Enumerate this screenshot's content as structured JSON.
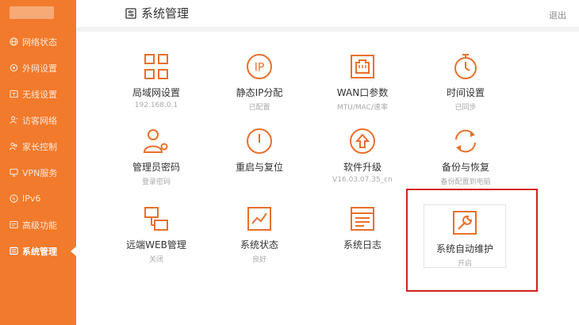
{
  "header": {
    "title": "系统管理",
    "logout": "退出"
  },
  "sidebar": {
    "items": [
      {
        "label": "网络状态",
        "icon": "globe-icon"
      },
      {
        "label": "外网设置",
        "icon": "wan-settings-icon"
      },
      {
        "label": "无线设置",
        "icon": "wireless-icon"
      },
      {
        "label": "访客网络",
        "icon": "guest-icon"
      },
      {
        "label": "家长控制",
        "icon": "parental-control-icon"
      },
      {
        "label": "VPN服务",
        "icon": "vpn-shield-icon"
      },
      {
        "label": "IPv6",
        "icon": "ipv6-icon"
      },
      {
        "label": "高级功能",
        "icon": "advanced-icon"
      },
      {
        "label": "系统管理",
        "icon": "system-management-icon",
        "active": true
      }
    ]
  },
  "tiles": [
    {
      "label": "局域网设置",
      "sub": "192.168.0.1",
      "icon": "lan-icon"
    },
    {
      "label": "静态IP分配",
      "sub": "已配置",
      "icon": "ip-icon"
    },
    {
      "label": "WAN口参数",
      "sub": "MTU/MAC/速率",
      "icon": "wan-port-icon"
    },
    {
      "label": "时间设置",
      "sub": "已同步",
      "icon": "clock-icon"
    },
    {
      "label": "管理员密码",
      "sub": "登录密码",
      "icon": "admin-key-icon"
    },
    {
      "label": "重启与复位",
      "sub": "",
      "icon": "power-icon"
    },
    {
      "label": "软件升级",
      "sub": "V16.03.07.35_cn",
      "icon": "upgrade-icon"
    },
    {
      "label": "备份与恢复",
      "sub": "备份配置到电脑",
      "icon": "backup-restore-icon"
    },
    {
      "label": "远端WEB管理",
      "sub": "关闭",
      "icon": "remote-web-icon"
    },
    {
      "label": "系统状态",
      "sub": "良好",
      "icon": "system-status-icon"
    },
    {
      "label": "系统日志",
      "sub": "",
      "icon": "system-log-icon"
    },
    {
      "label": "系统自动维护",
      "sub": "开启",
      "icon": "wrench-icon"
    }
  ],
  "colors": {
    "brand": "#f27a2c",
    "icon": "#e8702a",
    "highlight": "#d42020"
  }
}
